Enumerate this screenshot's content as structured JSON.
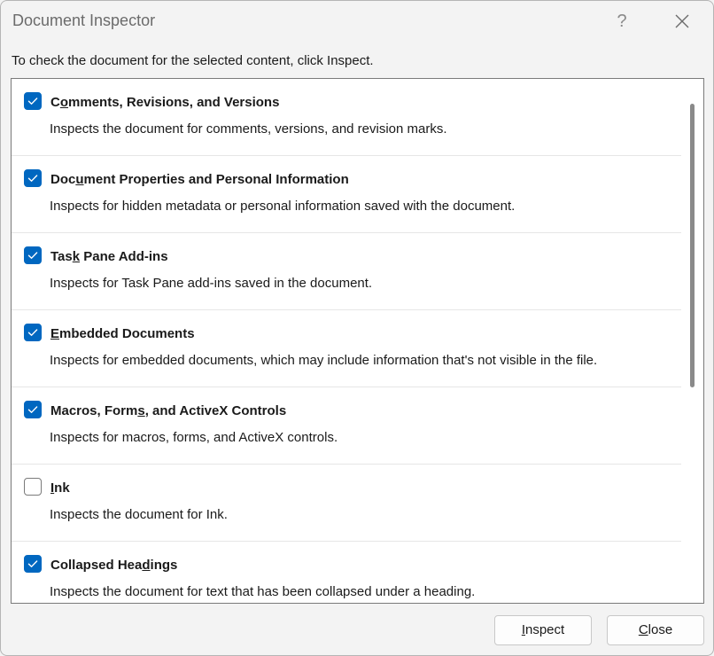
{
  "window": {
    "title": "Document Inspector",
    "help_label": "?"
  },
  "instruction": "To check the document for the selected content, click Inspect.",
  "items": [
    {
      "title_pre": "C",
      "title_key": "o",
      "title_post": "mments, Revisions, and Versions",
      "description": "Inspects the document for comments, versions, and revision marks.",
      "checked": true
    },
    {
      "title_pre": "Doc",
      "title_key": "u",
      "title_post": "ment Properties and Personal Information",
      "description": "Inspects for hidden metadata or personal information saved with the document.",
      "checked": true
    },
    {
      "title_pre": "Tas",
      "title_key": "k",
      "title_post": " Pane Add-ins",
      "description": "Inspects for Task Pane add-ins saved in the document.",
      "checked": true
    },
    {
      "title_pre": "",
      "title_key": "E",
      "title_post": "mbedded Documents",
      "description": "Inspects for embedded documents, which may include information that's not visible in the file.",
      "checked": true
    },
    {
      "title_pre": "Macros, Form",
      "title_key": "s",
      "title_post": ", and ActiveX Controls",
      "description": "Inspects for macros, forms, and ActiveX controls.",
      "checked": true
    },
    {
      "title_pre": "",
      "title_key": "I",
      "title_post": "nk",
      "description": "Inspects the document for Ink.",
      "checked": false
    },
    {
      "title_pre": "Collapsed Hea",
      "title_key": "d",
      "title_post": "ings",
      "description": "Inspects the document for text that has been collapsed under a heading.",
      "checked": true
    }
  ],
  "buttons": {
    "inspect_key": "I",
    "inspect_rest": "nspect",
    "close_key": "C",
    "close_rest": "lose"
  },
  "colors": {
    "checkbox_checked": "#0067c0",
    "dialog_bg": "#f3f3f3",
    "list_bg": "#ffffff"
  },
  "icons": {
    "help": "question-mark",
    "close": "x-close",
    "checkmark": "checkmark"
  }
}
